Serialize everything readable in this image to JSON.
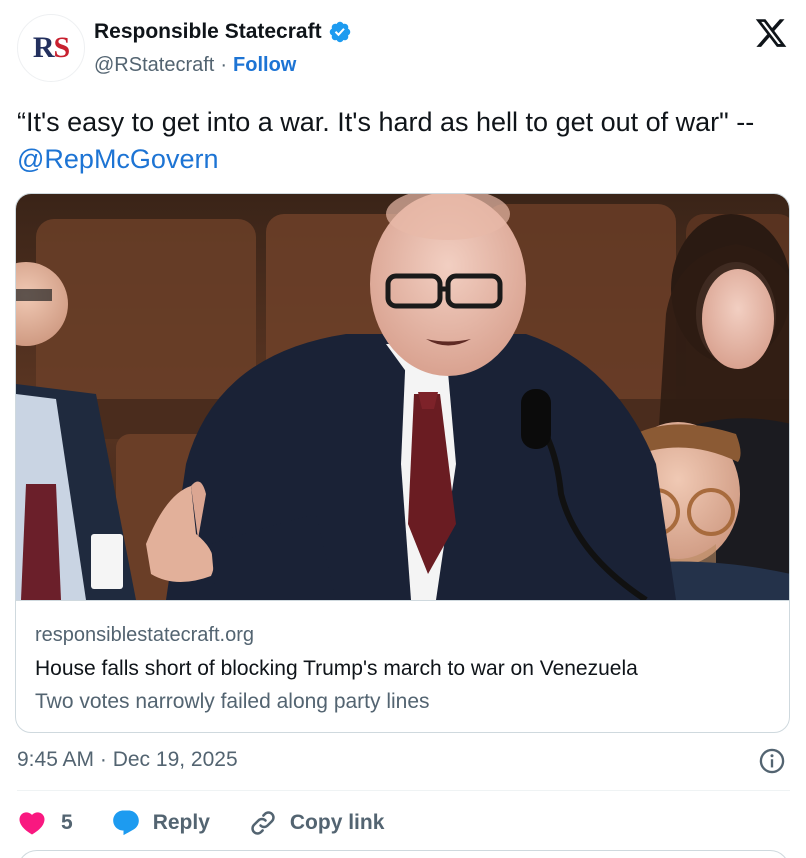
{
  "author": {
    "avatar_letters": {
      "first": "R",
      "second": "S"
    },
    "display_name": "Responsible Statecraft",
    "handle": "@RStatecraft",
    "separator": "·",
    "follow_label": "Follow",
    "verified_color": "#1d9bf0"
  },
  "tweet": {
    "text": "“It's easy to get into a war. It's hard as hell to get out of war\" -- ",
    "mention": "@RepMcGovern"
  },
  "card": {
    "image_description": "Photo of a congressman speaking at a microphone on the House floor",
    "domain": "responsiblestatecraft.org",
    "title": "House falls short of blocking Trump's march to war on Venezuela",
    "description": "Two votes narrowly failed along party lines"
  },
  "meta": {
    "timestamp": "9:45 AM · Dec 19, 2025"
  },
  "actions": {
    "like_count": "5",
    "reply_label": "Reply",
    "copy_link_label": "Copy link"
  },
  "colors": {
    "accent": "#1d74d4",
    "like": "#f91880",
    "reply_icon": "#1d9bf0",
    "secondary_text": "#536471"
  }
}
